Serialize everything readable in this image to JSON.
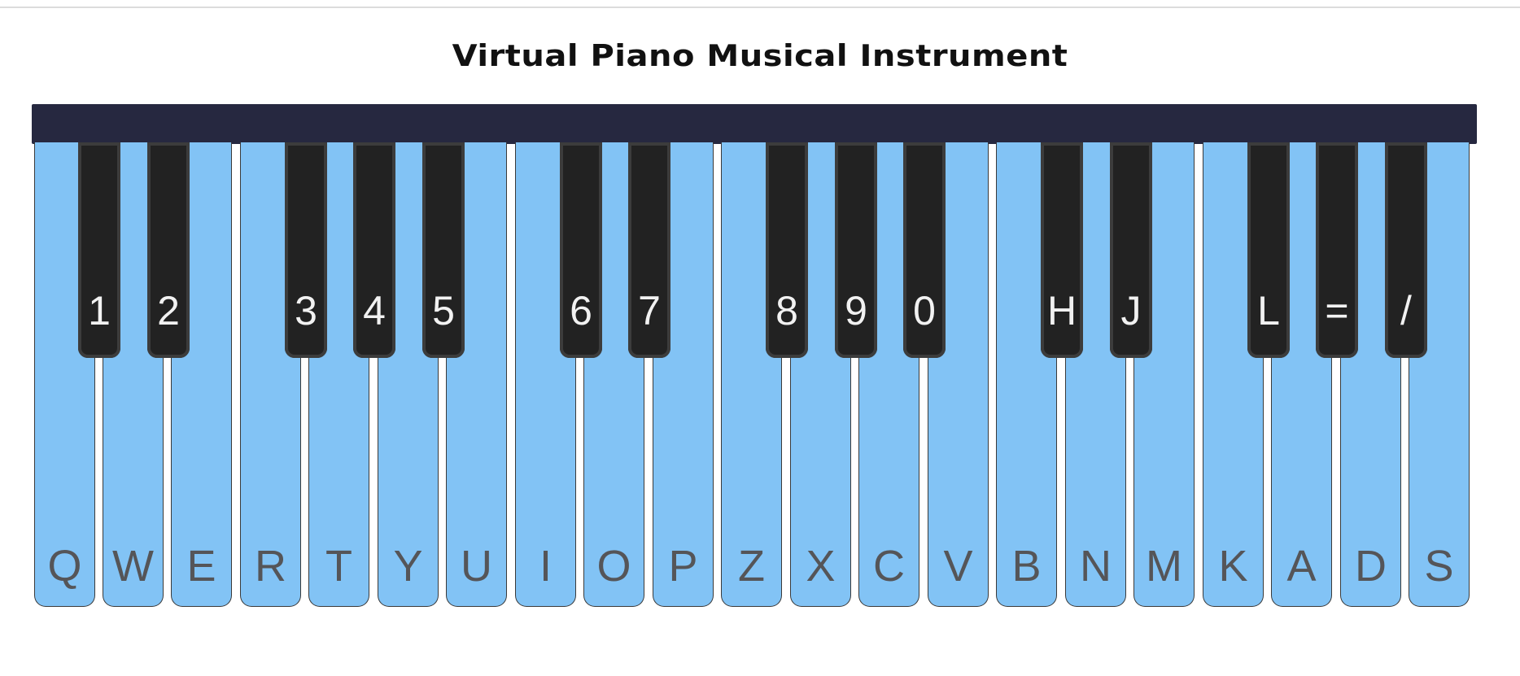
{
  "page": {
    "title": "Virtual Piano Musical Instrument"
  },
  "colors": {
    "white_key": "#82c3f5",
    "black_key": "#222222",
    "top_bar": "#262840"
  },
  "keys": {
    "white": [
      {
        "label": "Q"
      },
      {
        "label": "W"
      },
      {
        "label": "E"
      },
      {
        "label": "R"
      },
      {
        "label": "T"
      },
      {
        "label": "Y"
      },
      {
        "label": "U"
      },
      {
        "label": "I"
      },
      {
        "label": "O"
      },
      {
        "label": "P"
      },
      {
        "label": "Z"
      },
      {
        "label": "X"
      },
      {
        "label": "C"
      },
      {
        "label": "V"
      },
      {
        "label": "B"
      },
      {
        "label": "N"
      },
      {
        "label": "M"
      },
      {
        "label": "K"
      },
      {
        "label": "A"
      },
      {
        "label": "D"
      },
      {
        "label": "S"
      }
    ],
    "black": [
      {
        "label": "1"
      },
      {
        "label": "2"
      },
      {
        "label": "3"
      },
      {
        "label": "4"
      },
      {
        "label": "5"
      },
      {
        "label": "6"
      },
      {
        "label": "7"
      },
      {
        "label": "8"
      },
      {
        "label": "9"
      },
      {
        "label": "0"
      },
      {
        "label": "H"
      },
      {
        "label": "J"
      },
      {
        "label": "L"
      },
      {
        "label": "="
      },
      {
        "label": "/"
      }
    ]
  }
}
